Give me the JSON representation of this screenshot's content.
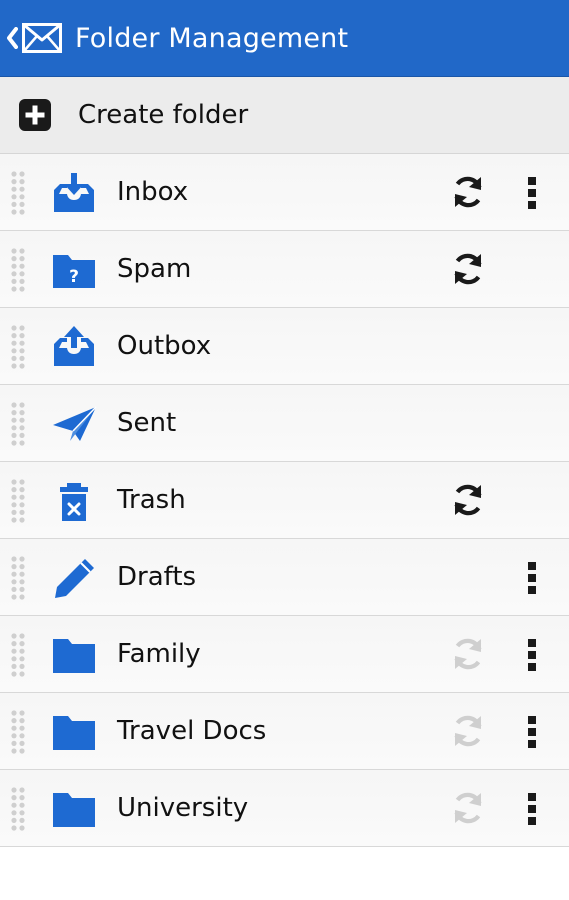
{
  "header": {
    "title": "Folder Management"
  },
  "create_folder": {
    "label": "Create folder"
  },
  "colors": {
    "appbar": "#2168c8",
    "icon_blue": "#1e6ad2",
    "sync_active": "#1a1a1a",
    "sync_inactive": "#cfcfcf"
  },
  "folders": [
    {
      "name": "Inbox",
      "icon": "inbox-icon",
      "sync": "active",
      "menu": true
    },
    {
      "name": "Spam",
      "icon": "spam-folder-icon",
      "sync": "active",
      "menu": false
    },
    {
      "name": "Outbox",
      "icon": "outbox-icon",
      "sync": "none",
      "menu": false
    },
    {
      "name": "Sent",
      "icon": "paper-plane-icon",
      "sync": "none",
      "menu": false
    },
    {
      "name": "Trash",
      "icon": "trash-icon",
      "sync": "active",
      "menu": false
    },
    {
      "name": "Drafts",
      "icon": "pencil-icon",
      "sync": "none",
      "menu": true
    },
    {
      "name": "Family",
      "icon": "folder-icon",
      "sync": "inactive",
      "menu": true
    },
    {
      "name": "Travel Docs",
      "icon": "folder-icon",
      "sync": "inactive",
      "menu": true
    },
    {
      "name": "University",
      "icon": "folder-icon",
      "sync": "inactive",
      "menu": true
    }
  ]
}
